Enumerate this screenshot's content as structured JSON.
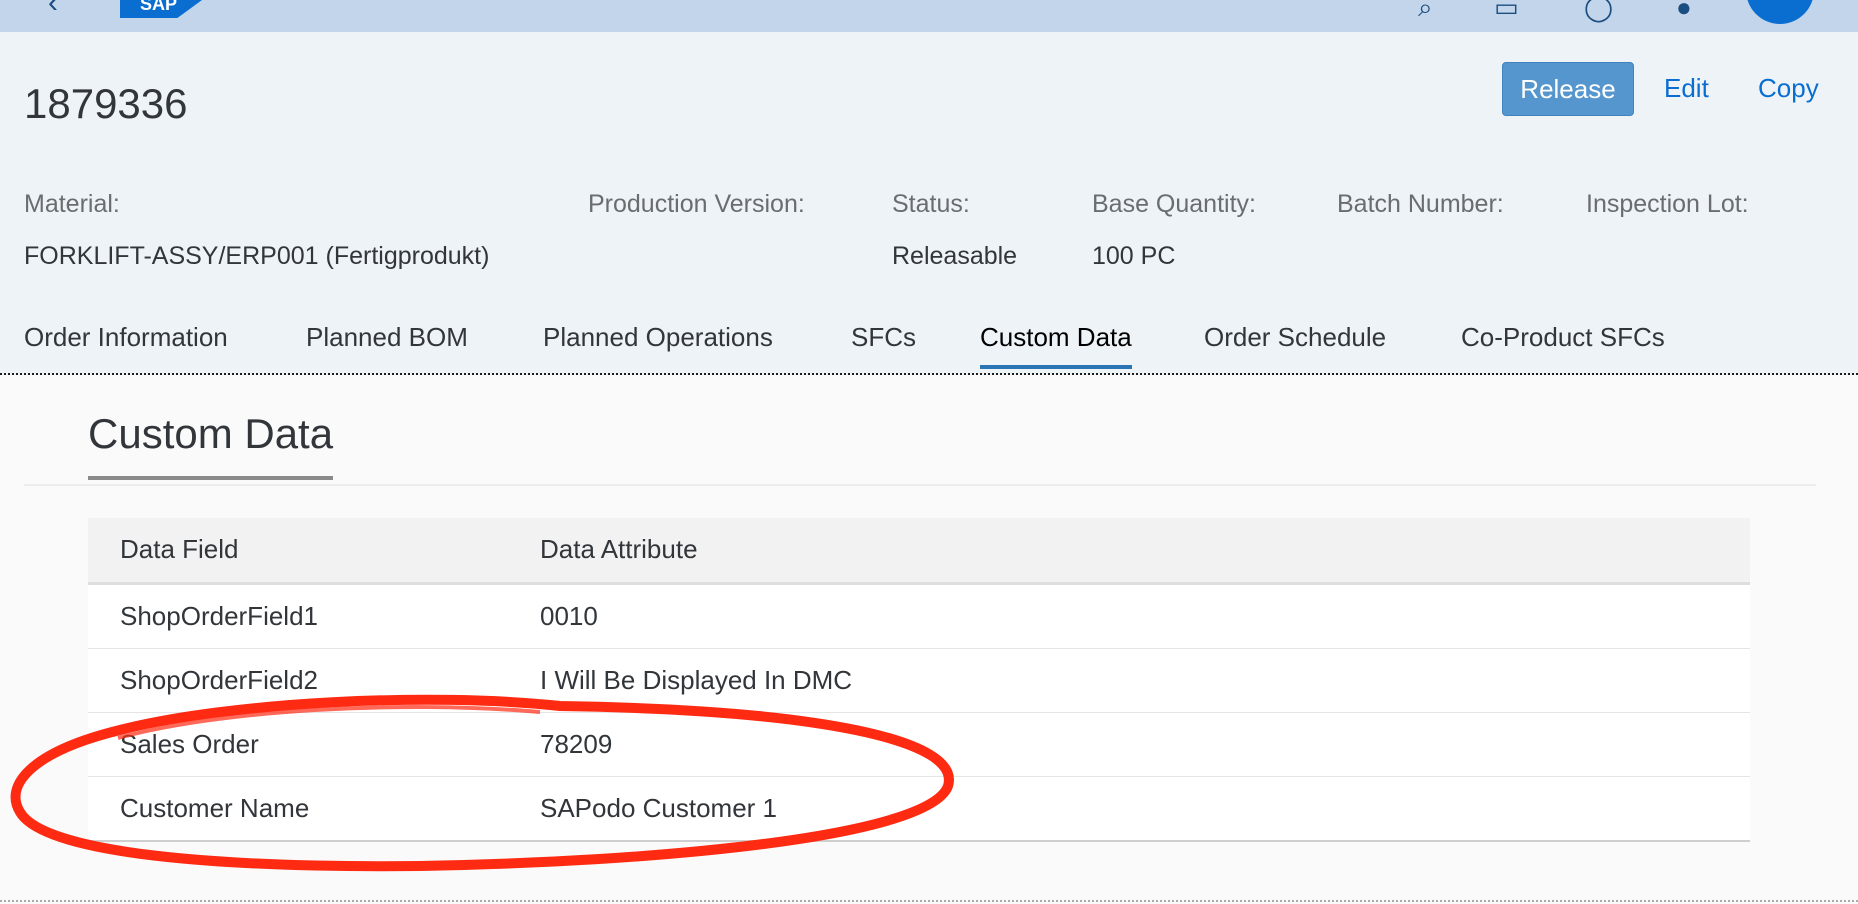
{
  "shell": {
    "logo_text": "SAP",
    "icons": [
      "back-icon",
      "search-icon",
      "notes-icon",
      "help-icon",
      "notifications-icon",
      "avatar"
    ]
  },
  "header": {
    "title": "1879336",
    "actions": {
      "release": "Release",
      "edit": "Edit",
      "copy": "Copy"
    },
    "attributes": {
      "material_label": "Material:",
      "material_value": "FORKLIFT-ASSY/ERP001 (Fertigprodukt)",
      "production_version_label": "Production Version:",
      "status_label": "Status:",
      "status_value": "Releasable",
      "base_quantity_label": "Base Quantity:",
      "base_quantity_value": "100 PC",
      "batch_number_label": "Batch Number:",
      "inspection_lot_label": "Inspection Lot:"
    }
  },
  "tabs": {
    "order_information": "Order Information",
    "planned_bom": "Planned BOM",
    "planned_operations": "Planned Operations",
    "sfcs": "SFCs",
    "custom_data": "Custom Data",
    "order_schedule": "Order Schedule",
    "co_product_sfcs": "Co-Product SFCs",
    "active": "Custom Data"
  },
  "section": {
    "title": "Custom Data",
    "table": {
      "headers": [
        "Data Field",
        "Data Attribute"
      ],
      "rows": [
        [
          "ShopOrderField1",
          "0010"
        ],
        [
          "ShopOrderField2",
          "I Will Be Displayed In DMC"
        ],
        [
          "Sales Order",
          "78209"
        ],
        [
          "Customer Name",
          "SAPodo Customer 1"
        ]
      ]
    }
  },
  "colors": {
    "shell_bg": "#c3d5ea",
    "header_bg": "#eef3f8",
    "accent": "#0a6ed1",
    "release_button": "#5496cd",
    "annotation": "#ff2a12"
  }
}
